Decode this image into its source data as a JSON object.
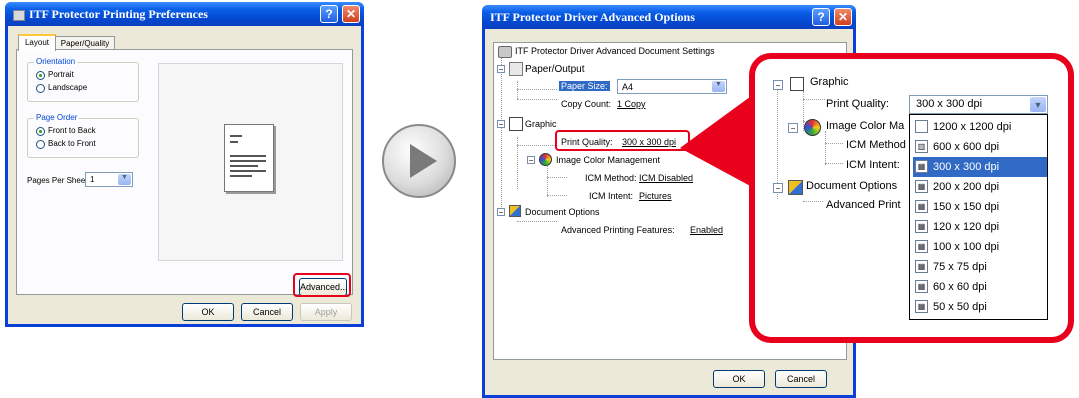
{
  "win1": {
    "title": "ITF Protector Printing Preferences",
    "tabs": [
      "Layout",
      "Paper/Quality"
    ],
    "orientation": {
      "label": "Orientation",
      "portrait": "Portrait",
      "landscape": "Landscape",
      "selected": "Portrait"
    },
    "page_order": {
      "label": "Page Order",
      "front_to_back": "Front to Back",
      "back_to_front": "Back to Front",
      "selected": "Front to Back"
    },
    "pages_per_sheet": {
      "label": "Pages Per Sheet:",
      "value": "1"
    },
    "advanced_button": "Advanced...",
    "ok_button": "OK",
    "cancel_button": "Cancel",
    "apply_button": "Apply"
  },
  "win2": {
    "title": "ITF Protector Driver Advanced Options",
    "root": "ITF Protector Driver Advanced Document Settings",
    "paper_output": "Paper/Output",
    "paper_size_label": "Paper Size:",
    "paper_size_value": "A4",
    "copy_count_label": "Copy Count:",
    "copy_count_value": "1 Copy",
    "graphic": "Graphic",
    "print_quality_label": "Print Quality:",
    "print_quality_value": "300 x 300 dpi",
    "icm": "Image Color Management",
    "icm_method_label": "ICM Method:",
    "icm_method_value": "ICM Disabled",
    "icm_intent_label": "ICM Intent:",
    "icm_intent_value": "Pictures",
    "doc_options": "Document Options",
    "adv_features_label": "Advanced Printing Features:",
    "adv_features_value": "Enabled",
    "ok_button": "OK",
    "cancel_button": "Cancel"
  },
  "zoom": {
    "graphic": "Graphic",
    "print_quality_label": "Print Quality:",
    "print_quality_value": "300 x 300 dpi",
    "icm": "Image Color Ma",
    "icm_method": "ICM Method",
    "icm_intent": "ICM Intent:",
    "doc_options": "Document Options",
    "adv_print": "Advanced Print",
    "dpi_options": [
      "1200 x 1200 dpi",
      "600 x 600 dpi",
      "300 x 300 dpi",
      "200 x 200 dpi",
      "150 x 150 dpi",
      "120 x 120 dpi",
      "100 x 100 dpi",
      "75 x 75 dpi",
      "60 x 60 dpi",
      "50 x 50 dpi"
    ],
    "selected_index": 2
  },
  "colors": {
    "highlight": "#e8001c",
    "selection": "#316ac5",
    "xp_title": "#0a5fe8"
  }
}
